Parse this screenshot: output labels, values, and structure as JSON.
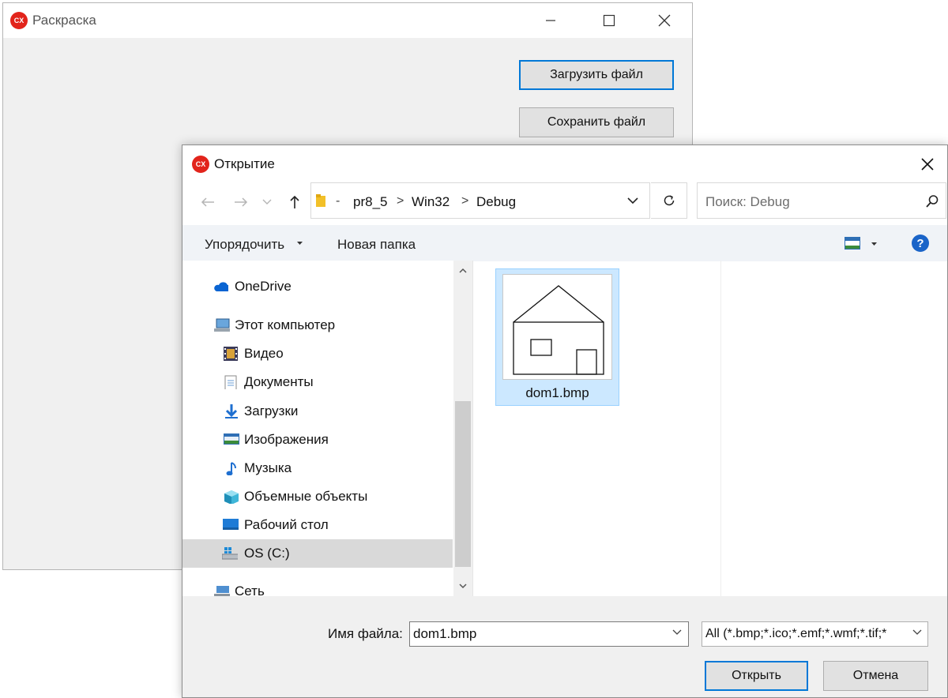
{
  "main_window": {
    "title": "Раскраска",
    "app_icon_text": "CX",
    "load_button": "Загрузить файл",
    "save_button": "Сохранить файл"
  },
  "dialog": {
    "title": "Открытие",
    "app_icon_text": "CX",
    "breadcrumb": [
      "pr8_5",
      "Win32",
      "Debug"
    ],
    "search_placeholder": "Поиск: Debug",
    "toolbar": {
      "organize": "Упорядочить",
      "new_folder": "Новая папка"
    },
    "nav_items": [
      {
        "label": "OneDrive",
        "icon": "onedrive-icon"
      },
      {
        "label": "Этот компьютер",
        "icon": "computer-icon"
      },
      {
        "label": "Видео",
        "icon": "video-icon"
      },
      {
        "label": "Документы",
        "icon": "documents-icon"
      },
      {
        "label": "Загрузки",
        "icon": "downloads-icon"
      },
      {
        "label": "Изображения",
        "icon": "pictures-icon"
      },
      {
        "label": "Музыка",
        "icon": "music-icon"
      },
      {
        "label": "Объемные объекты",
        "icon": "3d-objects-icon"
      },
      {
        "label": "Рабочий стол",
        "icon": "desktop-icon"
      },
      {
        "label": "OS (C:)",
        "icon": "drive-icon",
        "selected": true
      },
      {
        "label": "Сеть",
        "icon": "network-icon"
      }
    ],
    "files": [
      {
        "name": "dom1.bmp",
        "selected": true
      }
    ],
    "filename_label": "Имя файла:",
    "filename_value": "dom1.bmp",
    "filetype_value": "All (*.bmp;*.ico;*.emf;*.wmf;*.tif;*",
    "open_button": "Открыть",
    "cancel_button": "Отмена"
  },
  "colors": {
    "accent": "#0078d7",
    "selection": "#cce8ff",
    "app_icon": "#e2241b"
  }
}
